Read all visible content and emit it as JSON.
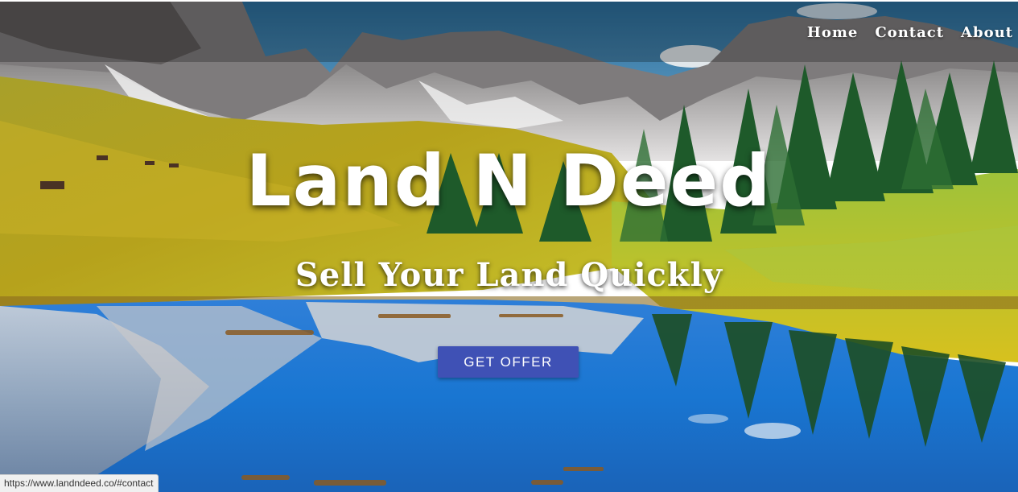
{
  "nav": {
    "items": [
      {
        "label": "Home"
      },
      {
        "label": "Contact"
      },
      {
        "label": "About"
      }
    ]
  },
  "hero": {
    "title": "Land N Deed",
    "subtitle": "Sell Your Land Quickly",
    "cta_label": "GET OFFER",
    "background_icon": "mountain-lake-landscape"
  },
  "status_bar": {
    "url": "https://www.landndeed.co/#contact"
  },
  "colors": {
    "button": "#3f51b5",
    "text": "#ffffff",
    "nav_overlay": "rgba(0,0,0,0.25)"
  }
}
